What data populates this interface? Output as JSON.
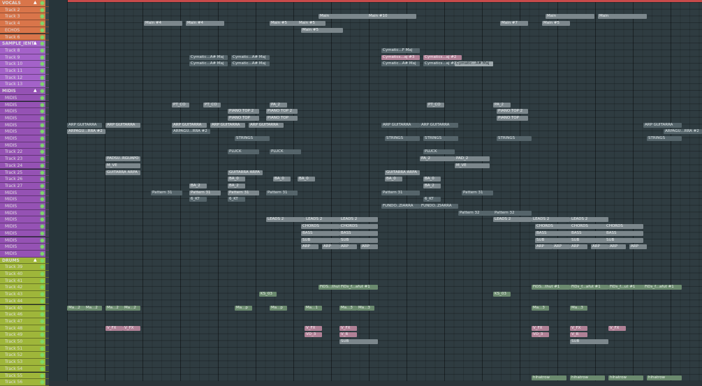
{
  "ruler_color": "#c84a4a",
  "groups": {
    "vocals": {
      "label": "VOCALS",
      "color": "#d9754a"
    },
    "samples": {
      "label": "SAMPLE_IENTS",
      "color": "#a462c9"
    },
    "midis": {
      "label": "MIDIS",
      "color": "#9552b4"
    },
    "drums": {
      "label": "DRUMS",
      "color": "#9fb63a"
    }
  },
  "tracks": [
    {
      "label": "VOCALS",
      "group": "vocals",
      "header": true
    },
    {
      "label": "Track 2",
      "group": "vocals"
    },
    {
      "label": "Track 3",
      "group": "vocals"
    },
    {
      "label": "Track 4",
      "group": "vocals"
    },
    {
      "label": "ECHOS",
      "group": "vocals"
    },
    {
      "label": "Track 6",
      "group": "vocals"
    },
    {
      "label": "SAMPLE_IENTS",
      "group": "samples",
      "header": true
    },
    {
      "label": "Track 8",
      "group": "samples"
    },
    {
      "label": "Track 9",
      "group": "samples"
    },
    {
      "label": "Track 10",
      "group": "samples"
    },
    {
      "label": "Track 11",
      "group": "samples"
    },
    {
      "label": "Track 12",
      "group": "samples"
    },
    {
      "label": "Track 13",
      "group": "samples"
    },
    {
      "label": "MIDIS",
      "group": "midis",
      "header": true
    },
    {
      "label": "MIDIS",
      "group": "midis"
    },
    {
      "label": "MIDIS",
      "group": "midis"
    },
    {
      "label": "MIDIS",
      "group": "midis"
    },
    {
      "label": "MIDIS",
      "group": "midis"
    },
    {
      "label": "MIDIS",
      "group": "midis"
    },
    {
      "label": "MIDIS",
      "group": "midis"
    },
    {
      "label": "MIDIS",
      "group": "midis"
    },
    {
      "label": "MIDIS",
      "group": "midis"
    },
    {
      "label": "Track 22",
      "group": "midis"
    },
    {
      "label": "Track 23",
      "group": "midis"
    },
    {
      "label": "Track 24",
      "group": "midis"
    },
    {
      "label": "Track 25",
      "group": "midis"
    },
    {
      "label": "Track 26",
      "group": "midis"
    },
    {
      "label": "Track 27",
      "group": "midis"
    },
    {
      "label": "MIDIS",
      "group": "midis"
    },
    {
      "label": "MIDIS",
      "group": "midis"
    },
    {
      "label": "MIDIS",
      "group": "midis"
    },
    {
      "label": "MIDIS",
      "group": "midis"
    },
    {
      "label": "MIDIS",
      "group": "midis"
    },
    {
      "label": "MIDIS",
      "group": "midis"
    },
    {
      "label": "MIDIS",
      "group": "midis"
    },
    {
      "label": "MIDIS",
      "group": "midis"
    },
    {
      "label": "MIDIS",
      "group": "midis"
    },
    {
      "label": "MIDIS",
      "group": "midis"
    },
    {
      "label": "DRUMS",
      "group": "drums",
      "header": true
    },
    {
      "label": "Track 39",
      "group": "drums"
    },
    {
      "label": "Track 40",
      "group": "drums"
    },
    {
      "label": "Track 41",
      "group": "drums"
    },
    {
      "label": "Track 42",
      "group": "drums"
    },
    {
      "label": "Track 43",
      "group": "drums"
    },
    {
      "label": "Track 44",
      "group": "drums"
    },
    {
      "label": "Track 45",
      "group": "drums"
    },
    {
      "label": "Track 46",
      "group": "drums"
    },
    {
      "label": "Track 47",
      "group": "drums"
    },
    {
      "label": "Track 48",
      "group": "drums"
    },
    {
      "label": "Track 49",
      "group": "drums"
    },
    {
      "label": "Track 50",
      "group": "drums"
    },
    {
      "label": "Track 51",
      "group": "drums"
    },
    {
      "label": "Track 52",
      "group": "drums"
    },
    {
      "label": "Track 53",
      "group": "drums"
    },
    {
      "label": "Track 54",
      "group": "drums"
    },
    {
      "label": "Track 55",
      "group": "drums"
    },
    {
      "label": "Track 56",
      "group": "drums"
    }
  ],
  "clips": [
    {
      "text": "Main",
      "row": 2,
      "style": "c-grey"
    },
    {
      "text": "Main #10",
      "row": 2,
      "style": "c-grey"
    },
    {
      "text": "Main",
      "row": 2,
      "style": "c-grey"
    },
    {
      "text": "Main",
      "row": 2,
      "style": "c-grey"
    },
    {
      "text": "Main #4",
      "row": 3,
      "style": "c-grey"
    },
    {
      "text": "Main #4",
      "row": 3,
      "style": "c-grey"
    },
    {
      "text": "Main #5",
      "row": 3,
      "style": "c-grey"
    },
    {
      "text": "Main #5",
      "row": 3,
      "style": "c-grey"
    },
    {
      "text": "Main #7",
      "row": 3,
      "style": "c-grey"
    },
    {
      "text": "Main #5",
      "row": 3,
      "style": "c-grey"
    },
    {
      "text": "Main #5",
      "row": 4,
      "style": "c-grey"
    },
    {
      "text": "Cymatic...F Maj",
      "row": 7,
      "style": "c-dark"
    },
    {
      "text": "Cymatic...A# Maj",
      "row": 8,
      "style": "c-dark"
    },
    {
      "text": "Cymatic...A# Maj",
      "row": 8,
      "style": "c-dark"
    },
    {
      "text": "Cymatics...aj #3",
      "row": 8,
      "style": "c-pink"
    },
    {
      "text": "Cymatics...aj #2",
      "row": 8,
      "style": "c-pink"
    },
    {
      "text": "Cymatic...A# Maj",
      "row": 9,
      "style": "c-dark"
    },
    {
      "text": "Cymatic...A# Maj",
      "row": 9,
      "style": "c-dark"
    },
    {
      "text": "Cymatic...A# Maj",
      "row": 9,
      "style": "c-dark"
    },
    {
      "text": "Cymatics...aj #2",
      "row": 9,
      "style": "c-dark"
    },
    {
      "text": "Cymatic...A# Maj",
      "row": 9,
      "style": "c-light"
    },
    {
      "text": "PT_CO",
      "row": 15,
      "style": "c-grey"
    },
    {
      "text": "PT_CO",
      "row": 15,
      "style": "c-grey"
    },
    {
      "text": "PA_2",
      "row": 15,
      "style": "c-grey"
    },
    {
      "text": "PT_CO",
      "row": 15,
      "style": "c-grey"
    },
    {
      "text": "PA_2",
      "row": 15,
      "style": "c-grey"
    },
    {
      "text": "PIANO TOP 2",
      "row": 16,
      "style": "c-grey"
    },
    {
      "text": "PIANO TOP 2",
      "row": 16,
      "style": "c-grey"
    },
    {
      "text": "PIANO TOP 2",
      "row": 16,
      "style": "c-grey"
    },
    {
      "text": "PIANO TOP",
      "row": 17,
      "style": "c-grey"
    },
    {
      "text": "PIANO TOP",
      "row": 17,
      "style": "c-grey"
    },
    {
      "text": "PIANO TOP",
      "row": 17,
      "style": "c-grey"
    },
    {
      "text": "ARP GUITARRA",
      "row": 18,
      "style": "c-dark"
    },
    {
      "text": "ARP GUITARRA",
      "row": 18,
      "style": "c-grey"
    },
    {
      "text": "ARP GUITARRA",
      "row": 18,
      "style": "c-grey"
    },
    {
      "text": "ARP GUITARRA",
      "row": 18,
      "style": "c-grey"
    },
    {
      "text": "ARP GUITARRA",
      "row": 18,
      "style": "c-grey"
    },
    {
      "text": "ARP GUITARRA",
      "row": 18,
      "style": "c-dark"
    },
    {
      "text": "ARP GUITARRA",
      "row": 18,
      "style": "c-dark"
    },
    {
      "text": "ARP GUITARRA",
      "row": 18,
      "style": "c-dark"
    },
    {
      "text": "ARPAGU...RRA #2",
      "row": 19,
      "style": "c-grey"
    },
    {
      "text": "ARPAGU...RRA #2",
      "row": 19,
      "style": "c-dark"
    },
    {
      "text": "ARPAGU...RRA #2",
      "row": 19,
      "style": "c-dark"
    },
    {
      "text": "STRINGS",
      "row": 20,
      "style": "c-dark"
    },
    {
      "text": "STRINGS",
      "row": 20,
      "style": "c-dark"
    },
    {
      "text": "STRINGS",
      "row": 20,
      "style": "c-dark"
    },
    {
      "text": "STRINGS",
      "row": 20,
      "style": "c-dark"
    },
    {
      "text": "STRINGS",
      "row": 20,
      "style": "c-dark"
    },
    {
      "text": "PLUCK",
      "row": 22,
      "style": "c-dark"
    },
    {
      "text": "PLUCK",
      "row": 22,
      "style": "c-dark"
    },
    {
      "text": "PLUCK",
      "row": 22,
      "style": "c-dark"
    },
    {
      "text": "PADSU..RGUAPO",
      "row": 23,
      "style": "c-grey"
    },
    {
      "text": "PA_2",
      "row": 23,
      "style": "c-grey"
    },
    {
      "text": "PAD_2",
      "row": 23,
      "style": "c-grey"
    },
    {
      "text": "M_VE",
      "row": 24,
      "style": "c-grey"
    },
    {
      "text": "M_VE",
      "row": 24,
      "style": "c-grey"
    },
    {
      "text": "GUITARRA ARPA",
      "row": 25,
      "style": "c-grey"
    },
    {
      "text": "GUITARRA ARPA",
      "row": 25,
      "style": "c-grey"
    },
    {
      "text": "GUITARRA ARPA",
      "row": 25,
      "style": "c-grey"
    },
    {
      "text": "BA_0",
      "row": 26,
      "style": "c-grey"
    },
    {
      "text": "BA_0",
      "row": 26,
      "style": "c-grey"
    },
    {
      "text": "BA_0",
      "row": 26,
      "style": "c-grey"
    },
    {
      "text": "BA_0",
      "row": 26,
      "style": "c-grey"
    },
    {
      "text": "BA_0",
      "row": 26,
      "style": "c-grey"
    },
    {
      "text": "BA_2",
      "row": 27,
      "style": "c-grey"
    },
    {
      "text": "BA_2",
      "row": 27,
      "style": "c-grey"
    },
    {
      "text": "BA_2",
      "row": 27,
      "style": "c-grey"
    },
    {
      "text": "Pattern 31",
      "row": 28,
      "style": "c-dark"
    },
    {
      "text": "Pattern 31",
      "row": 28,
      "style": "c-grey"
    },
    {
      "text": "Pattern 31",
      "row": 28,
      "style": "c-grey"
    },
    {
      "text": "Pattern 31",
      "row": 28,
      "style": "c-dark"
    },
    {
      "text": "Pattern 31",
      "row": 28,
      "style": "c-dark"
    },
    {
      "text": "Pattern 31",
      "row": 28,
      "style": "c-dark"
    },
    {
      "text": "6_KT",
      "row": 29,
      "style": "c-dark"
    },
    {
      "text": "6_KT",
      "row": 29,
      "style": "c-dark"
    },
    {
      "text": "6_KT",
      "row": 29,
      "style": "c-dark"
    },
    {
      "text": "FUNDO..ZIARRA",
      "row": 30,
      "style": "c-dark"
    },
    {
      "text": "FUNDO..ZIARRA",
      "row": 30,
      "style": "c-dark"
    },
    {
      "text": "Pattern 32",
      "row": 31,
      "style": "c-dark"
    },
    {
      "text": "Pattern 32",
      "row": 31,
      "style": "c-dark"
    },
    {
      "text": "LEADS 2",
      "row": 32,
      "style": "c-grey"
    },
    {
      "text": "LEADS 2",
      "row": 32,
      "style": "c-grey"
    },
    {
      "text": "LEADS 2",
      "row": 32,
      "style": "c-grey"
    },
    {
      "text": "LEADS 2",
      "row": 32,
      "style": "c-grey"
    },
    {
      "text": "LEADS 2",
      "row": 32,
      "style": "c-grey"
    },
    {
      "text": "LEADS 2",
      "row": 32,
      "style": "c-grey"
    },
    {
      "text": "CHORDS",
      "row": 33,
      "style": "c-grey"
    },
    {
      "text": "CHORDS",
      "row": 33,
      "style": "c-grey"
    },
    {
      "text": "CHORDS",
      "row": 33,
      "style": "c-grey"
    },
    {
      "text": "CHORDS",
      "row": 33,
      "style": "c-grey"
    },
    {
      "text": "CHORDS",
      "row": 33,
      "style": "c-grey"
    },
    {
      "text": "BASS",
      "row": 34,
      "style": "c-grey"
    },
    {
      "text": "BASS",
      "row": 34,
      "style": "c-grey"
    },
    {
      "text": "BASS",
      "row": 34,
      "style": "c-grey"
    },
    {
      "text": "BASS",
      "row": 34,
      "style": "c-grey"
    },
    {
      "text": "BASS",
      "row": 34,
      "style": "c-grey"
    },
    {
      "text": "SUB",
      "row": 35,
      "style": "c-grey"
    },
    {
      "text": "SUB",
      "row": 35,
      "style": "c-grey"
    },
    {
      "text": "SUB",
      "row": 35,
      "style": "c-grey"
    },
    {
      "text": "SUB",
      "row": 35,
      "style": "c-grey"
    },
    {
      "text": "SUB",
      "row": 35,
      "style": "c-grey"
    },
    {
      "text": "ARP",
      "row": 36,
      "style": "c-grey"
    },
    {
      "text": "ARP",
      "row": 36,
      "style": "c-grey"
    },
    {
      "text": "ARP",
      "row": 36,
      "style": "c-grey"
    },
    {
      "text": "ARP",
      "row": 36,
      "style": "c-grey"
    },
    {
      "text": "ARP",
      "row": 36,
      "style": "c-grey"
    },
    {
      "text": "ARP",
      "row": 36,
      "style": "c-grey"
    },
    {
      "text": "ARP",
      "row": 36,
      "style": "c-grey"
    },
    {
      "text": "ARP",
      "row": 36,
      "style": "c-grey"
    },
    {
      "text": "ARP",
      "row": 36,
      "style": "c-grey"
    },
    {
      "text": "ARP",
      "row": 36,
      "style": "c-grey"
    },
    {
      "text": "FiDS...thut #1",
      "row": 42,
      "style": "c-green"
    },
    {
      "text": "FiDs_f...afut #1",
      "row": 42,
      "style": "c-green"
    },
    {
      "text": "FiDS...thut #1",
      "row": 42,
      "style": "c-green"
    },
    {
      "text": "FiDs_f...afut #1",
      "row": 42,
      "style": "c-green"
    },
    {
      "text": "FiDs_f...ut #1",
      "row": 42,
      "style": "c-green"
    },
    {
      "text": "FiDs_f...afut #1",
      "row": 42,
      "style": "c-green"
    },
    {
      "text": "KS_03",
      "row": 43,
      "style": "c-green"
    },
    {
      "text": "KS_03",
      "row": 43,
      "style": "c-green"
    },
    {
      "text": "Ma...2",
      "row": 45,
      "style": "c-green"
    },
    {
      "text": "Ma...2",
      "row": 45,
      "style": "c-green"
    },
    {
      "text": "Ma...2",
      "row": 45,
      "style": "c-green"
    },
    {
      "text": "Ma...2",
      "row": 45,
      "style": "c-green"
    },
    {
      "text": "Ma...p",
      "row": 45,
      "style": "c-green"
    },
    {
      "text": "Ma...p",
      "row": 45,
      "style": "c-green"
    },
    {
      "text": "Ma...1",
      "row": 45,
      "style": "c-green"
    },
    {
      "text": "Ma...3",
      "row": 45,
      "style": "c-green"
    },
    {
      "text": "Ma...3",
      "row": 45,
      "style": "c-green"
    },
    {
      "text": "Ma...3",
      "row": 45,
      "style": "c-green"
    },
    {
      "text": "Ma...3",
      "row": 45,
      "style": "c-green"
    },
    {
      "text": "V_FX",
      "row": 48,
      "style": "c-pink"
    },
    {
      "text": "V_FX",
      "row": 48,
      "style": "c-pink"
    },
    {
      "text": "V_FX",
      "row": 48,
      "style": "c-pink"
    },
    {
      "text": "V_FX",
      "row": 48,
      "style": "c-pink"
    },
    {
      "text": "V_FX",
      "row": 48,
      "style": "c-pink"
    },
    {
      "text": "V_FX",
      "row": 48,
      "style": "c-pink"
    },
    {
      "text": "V_FX",
      "row": 48,
      "style": "c-pink"
    },
    {
      "text": "VO_3",
      "row": 49,
      "style": "c-pink"
    },
    {
      "text": "V_R",
      "row": 49,
      "style": "c-pink"
    },
    {
      "text": "VO_3",
      "row": 49,
      "style": "c-pink"
    },
    {
      "text": "V_R",
      "row": 49,
      "style": "c-pink"
    },
    {
      "text": "SUB",
      "row": 50,
      "style": "c-grey"
    },
    {
      "text": "SUB",
      "row": 50,
      "style": "c-grey"
    },
    {
      "text": "hihatrow",
      "row": 57,
      "style": "c-green"
    },
    {
      "text": "hihatrow",
      "row": 57,
      "style": "c-green"
    },
    {
      "text": "hihatrow",
      "row": 57,
      "style": "c-green"
    },
    {
      "text": "hihatrow",
      "row": 57,
      "style": "c-green"
    }
  ]
}
